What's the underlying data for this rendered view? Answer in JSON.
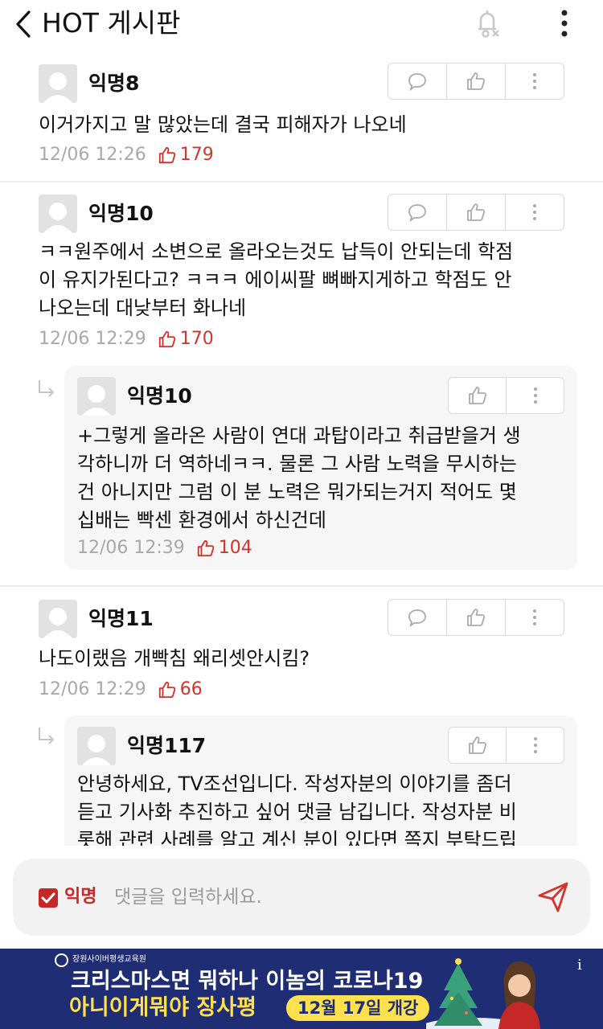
{
  "header": {
    "title": "HOT 게시판"
  },
  "comments": [
    {
      "author": "익명8",
      "text": "이거가지고 말 많았는데 결국 피해자가 나오네",
      "time": "12/06 12:26",
      "likes": "179"
    },
    {
      "author": "익명10",
      "text": "ㅋㅋ원주에서 소변으로 올라오는것도 납득이 안되는데 학점\n이 유지가된다고? ㅋㅋㅋ 에이씨팔 뼈빠지게하고 학점도 안\n나오는데 대낮부터 화나네",
      "time": "12/06 12:29",
      "likes": "170"
    },
    {
      "author": "익명10",
      "text": "+그렇게 올라온 사람이 연대 과탑이라고 취급받을거 생\n각하니까 더 역하네ㅋㅋ. 물론 그 사람 노력을 무시하는\n건 아니지만 그럼 이 분 노력은 뭐가되는거지 적어도 몇\n십배는 빡센 환경에서 하신건데",
      "time": "12/06 12:39",
      "likes": "104"
    },
    {
      "author": "익명11",
      "text": "나도이랬음 개빡침 왜리셋안시킴?",
      "time": "12/06 12:29",
      "likes": "66"
    },
    {
      "author": "익명117",
      "text": "안녕하세요, TV조선입니다. 작성자분의 이야기를 좀더\n듣고 기사화 추진하고 싶어 댓글 남깁니다. 작성자분 비\n롯해 관련 사례를 알고 계신 분이 있다면 쪽지 부탁드립"
    }
  ],
  "composer": {
    "anon_label": "익명",
    "placeholder": "댓글을 입력하세요."
  },
  "ad": {
    "org": "장원사이버평생교육원",
    "line1": "크리스마스면 뭐하나 이놈의 코로나19",
    "line2": "아니이게뭐야 장사평",
    "badge": "12월 17일 개강",
    "info": "i"
  },
  "colors": {
    "accent": "#d0342c",
    "ad_bg": "#1f2d75",
    "ad_yellow": "#ffe14d"
  }
}
